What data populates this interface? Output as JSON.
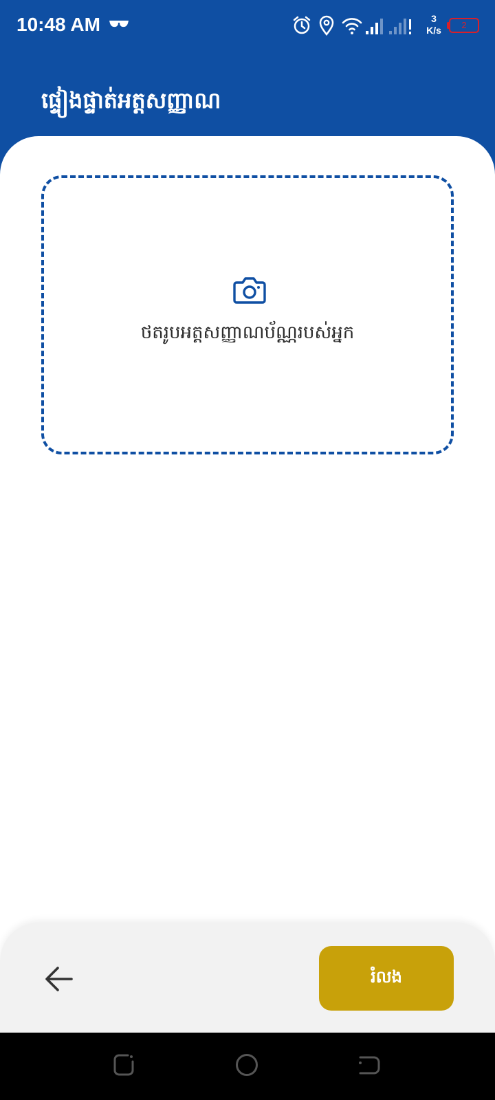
{
  "status_bar": {
    "time": "10:48 AM",
    "net_speed_value": "3",
    "net_speed_unit": "K/s",
    "battery_level": "2",
    "icons": [
      "glasses-icon",
      "alarm-icon",
      "location-icon",
      "wifi-icon",
      "signal-icon",
      "signal-2-icon",
      "battery-icon"
    ]
  },
  "header": {
    "title": "ផ្ទៀងផ្ទាត់អត្តសញ្ញាណ"
  },
  "upload": {
    "label": "ថតរូបអត្តសញ្ញាណប័ណ្ណរបស់អ្នក",
    "icon": "camera-icon"
  },
  "footer": {
    "back_icon": "arrow-left-icon",
    "skip_label": "រំលង"
  },
  "nav": {
    "icons": [
      "recents-icon",
      "home-icon",
      "back-icon"
    ]
  },
  "colors": {
    "primary": "#0f4fa3",
    "accent": "#c8a10a",
    "footer_bg": "#f2f2f2"
  }
}
